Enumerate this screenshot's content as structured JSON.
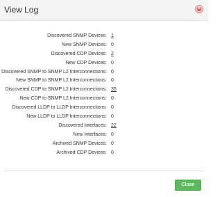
{
  "dialog": {
    "title": "View Log",
    "close_icon": "close-x-icon",
    "close_button_label": "Close",
    "accent_color": "#5cb85c",
    "close_icon_color": "#d9534f"
  },
  "log": [
    {
      "label": "Discovered SNMP Devices:",
      "value": "1",
      "link": true
    },
    {
      "label": "New SNMP Devices:",
      "value": "0",
      "link": false
    },
    {
      "label": "Discovered CDP Devices:",
      "value": "2",
      "link": true
    },
    {
      "label": "New CDP Devices:",
      "value": "0",
      "link": false
    },
    {
      "label": "Discovered SNMP to SNMP L2 Interconnections:",
      "value": "0",
      "link": false
    },
    {
      "label": "New SNMP to SNMP L2 Interconnections:",
      "value": "0",
      "link": false
    },
    {
      "label": "Discovered CDP to SNMP L2 Interconnections:",
      "value": "35",
      "link": true
    },
    {
      "label": "New CDP to SNMP L2 Interconnections:",
      "value": "0",
      "link": false
    },
    {
      "label": "Discovered LLDP to LLDP Interconnections:",
      "value": "0",
      "link": false
    },
    {
      "label": "New LLDP to LLDP Interconnections:",
      "value": "0",
      "link": false
    },
    {
      "label": "Discovered Interfaces:",
      "value": "22",
      "link": true
    },
    {
      "label": "New Interfaces:",
      "value": "0",
      "link": false
    },
    {
      "label": "Archived SNMP Devices:",
      "value": "0",
      "link": false
    },
    {
      "label": "Archived CDP Devices:",
      "value": "0",
      "link": false
    }
  ]
}
